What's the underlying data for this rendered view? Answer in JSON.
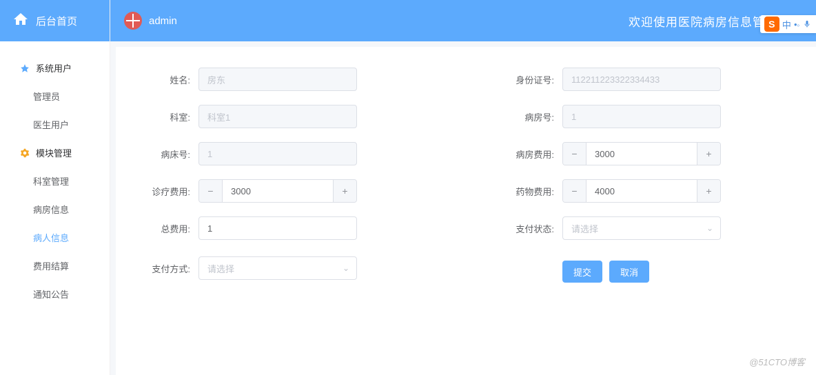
{
  "header": {
    "home_label": "后台首页",
    "username": "admin",
    "welcome": "欢迎使用医院病房信息管理系统"
  },
  "sidebar": {
    "categories": [
      {
        "label": "系统用户",
        "items": [
          "管理员",
          "医生用户"
        ]
      },
      {
        "label": "模块管理",
        "items": [
          "科室管理",
          "病房信息",
          "病人信息",
          "费用结算",
          "通知公告"
        ]
      }
    ],
    "active": "病人信息"
  },
  "form": {
    "labels": {
      "name": "姓名:",
      "id_number": "身份证号:",
      "department": "科室:",
      "ward_number": "病房号:",
      "bed_number": "病床号:",
      "ward_fee": "病房费用:",
      "treatment_fee": "诊疗费用:",
      "drug_fee": "药物费用:",
      "total_fee": "总费用:",
      "pay_status": "支付状态:",
      "pay_method": "支付方式:"
    },
    "values": {
      "name": "房东",
      "id_number": "112211223322334433",
      "department": "科室1",
      "ward_number": "1",
      "bed_number": "1",
      "ward_fee": "3000",
      "treatment_fee": "3000",
      "drug_fee": "4000",
      "total_fee": "1"
    },
    "select_placeholder": "请选择",
    "buttons": {
      "submit": "提交",
      "cancel": "取消"
    }
  },
  "watermark": "@51CTO博客",
  "ime": {
    "label": "中"
  }
}
